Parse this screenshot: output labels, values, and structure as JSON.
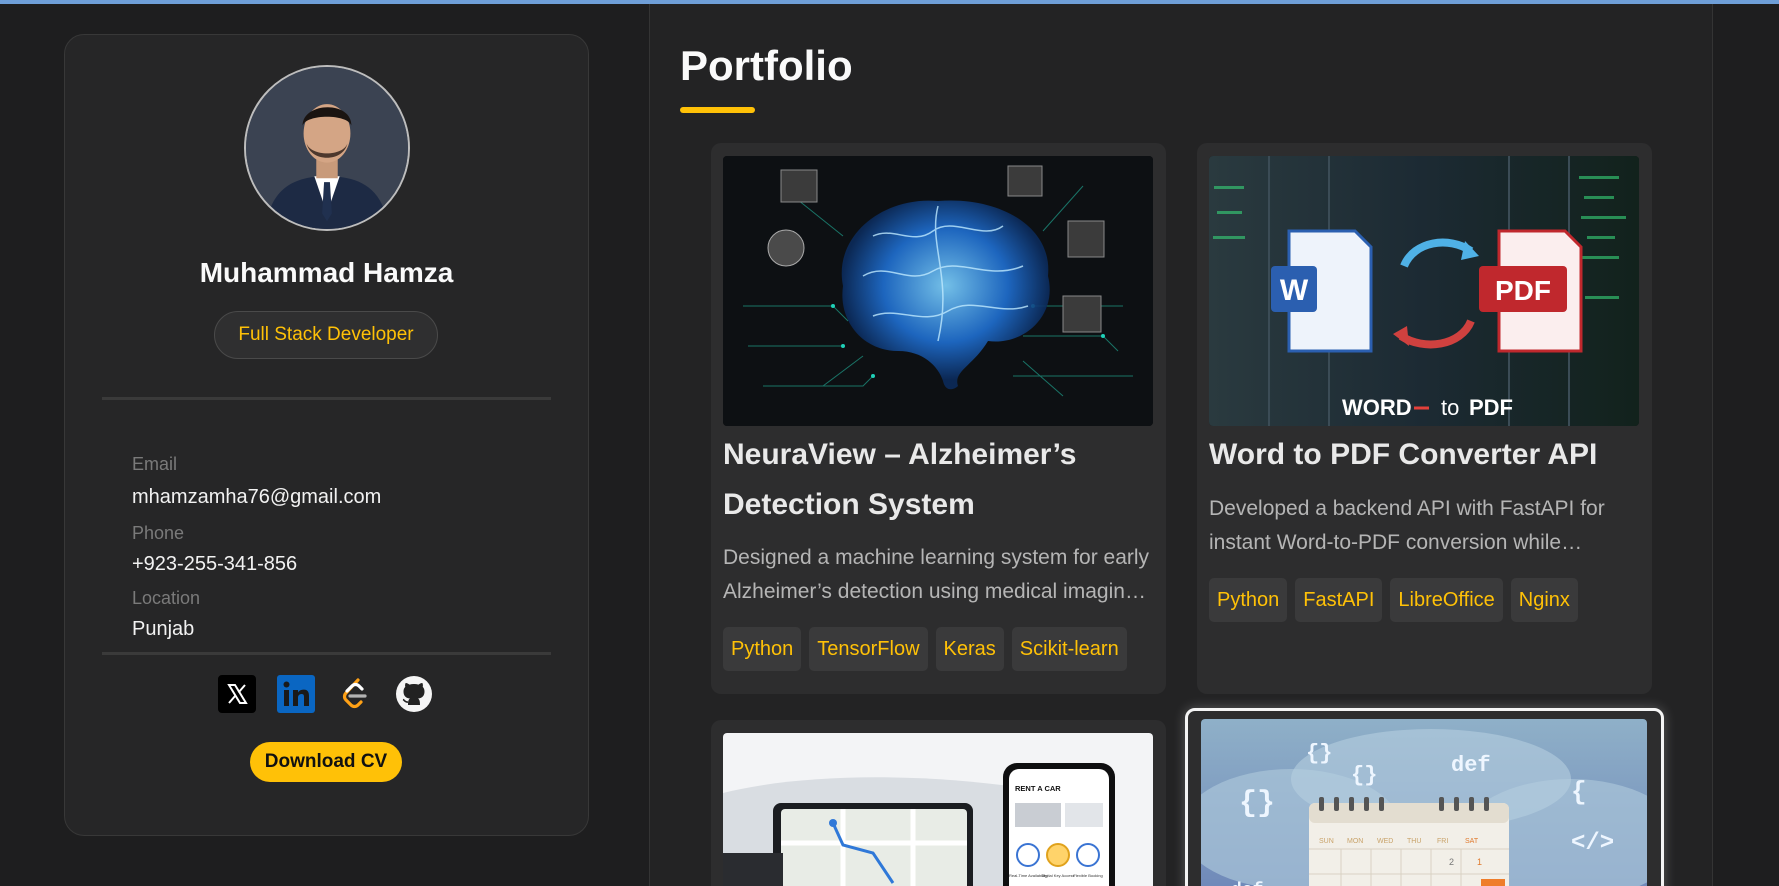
{
  "profile": {
    "name": "Muhammad Hamza",
    "role": "Full Stack Developer",
    "contacts": [
      {
        "label": "Email",
        "value": "mhamzamha76@gmail.com"
      },
      {
        "label": "Phone",
        "value": "+923-255-341-856"
      },
      {
        "label": "Location",
        "value": "Punjab"
      }
    ],
    "socials": [
      {
        "icon": "x-twitter-icon"
      },
      {
        "icon": "linkedin-icon"
      },
      {
        "icon": "leetcode-icon"
      },
      {
        "icon": "github-icon"
      }
    ],
    "download_label": "Download CV"
  },
  "portfolio": {
    "title": "Portfolio",
    "projects": [
      {
        "title": "NeuraView – Alzheimer’s Detection System",
        "description": "Designed a machine learning system for early Alzheimer’s detection using medical imaging and deep learning.",
        "tags": [
          "Python",
          "TensorFlow",
          "Keras",
          "Scikit-learn"
        ]
      },
      {
        "title": "Word to PDF Converter API",
        "description": "Developed a backend API with FastAPI for instant Word-to-PDF conversion while keeping formatting intact.",
        "tags": [
          "Python",
          "FastAPI",
          "LibreOffice",
          "Nginx"
        ],
        "image_text": {
          "w_letter": "W",
          "pdf": "PDF",
          "caption_left": "WORD",
          "caption_to": "to",
          "caption_right": "PDF"
        }
      },
      {
        "title": "",
        "image_text": {
          "app_header": "RENT A CAR",
          "feature_1": "Real-Time Availability",
          "feature_2": "Digital Key Access",
          "feature_3": "Flexible Booking"
        }
      },
      {
        "title": "",
        "image_text": {
          "braces": "{}",
          "def": "def",
          "tag": "</>",
          "days": [
            "SUN",
            "MON",
            "WED",
            "THU",
            "FRI",
            "SAT"
          ]
        }
      }
    ]
  },
  "colors": {
    "accent": "#ffc107",
    "background": "#1e1e1f",
    "panel": "#262627",
    "card": "#2d2d2e",
    "topbar": "#6f9fd8"
  }
}
